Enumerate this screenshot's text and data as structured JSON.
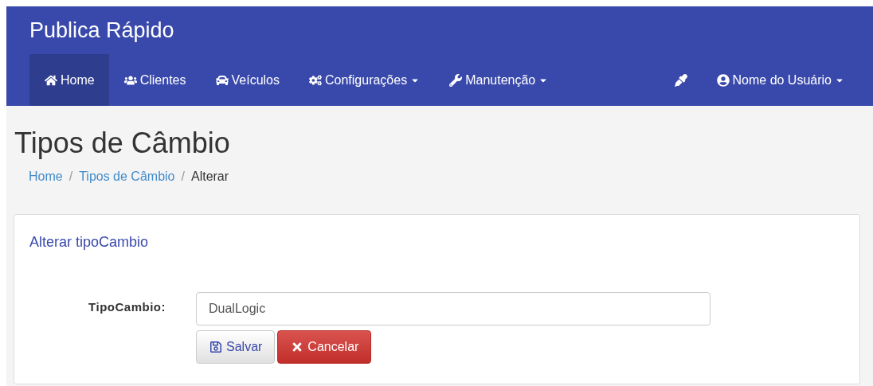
{
  "navbar": {
    "brand": "Publica Rápido",
    "items": [
      {
        "label": "Home",
        "selected": true,
        "dropdown": false
      },
      {
        "label": "Clientes",
        "selected": false,
        "dropdown": false
      },
      {
        "label": "Veículos",
        "selected": false,
        "dropdown": false
      },
      {
        "label": "Configurações",
        "selected": false,
        "dropdown": true
      },
      {
        "label": "Manutenção",
        "selected": false,
        "dropdown": true
      }
    ],
    "user": {
      "label": "Nome do Usuário",
      "dropdown": true
    }
  },
  "page": {
    "title": "Tipos de Câmbio",
    "breadcrumb_separator": "/",
    "breadcrumb": [
      {
        "label": "Home",
        "kind": "link"
      },
      {
        "label": "Tipos de Câmbio",
        "kind": "link"
      },
      {
        "label": "Alterar",
        "kind": "current"
      }
    ]
  },
  "form": {
    "title": "Alterar tipoCambio",
    "field": {
      "label": "TipoCambio:",
      "value": "DualLogic"
    },
    "buttons": [
      {
        "label": "Salvar",
        "kind": "default"
      },
      {
        "label": "Cancelar",
        "kind": "danger"
      }
    ]
  }
}
